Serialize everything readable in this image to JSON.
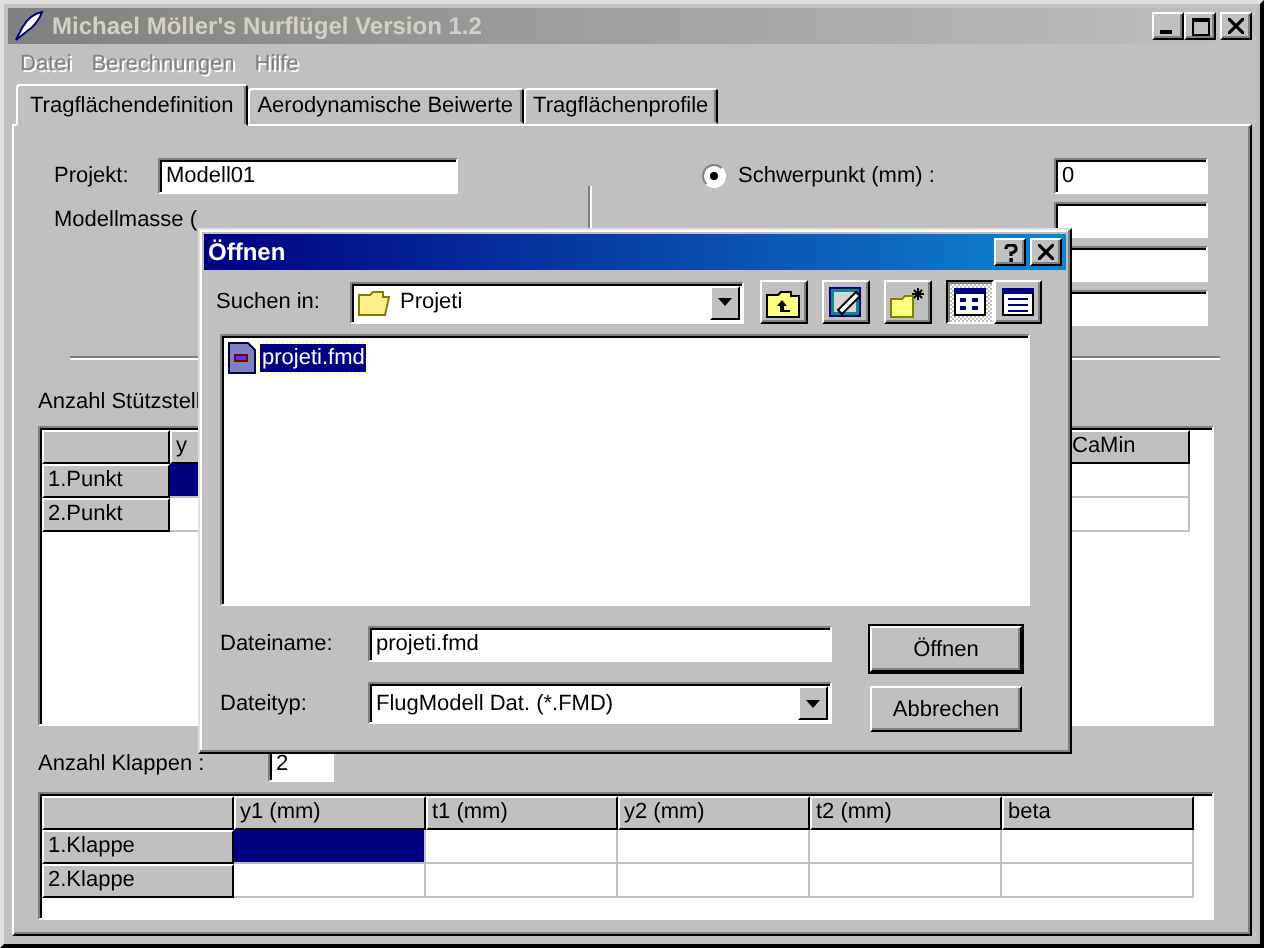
{
  "window": {
    "title": "Michael Möller's Nurflügel Version 1.2",
    "active": false
  },
  "menu": [
    {
      "label": "Datei",
      "disabled": true
    },
    {
      "label": "Berechnungen",
      "disabled": true
    },
    {
      "label": "Hilfe",
      "disabled": true
    }
  ],
  "tabs": [
    {
      "label": "Tragflächendefinition",
      "selected": true
    },
    {
      "label": "Aerodynamische Beiwerte",
      "selected": false
    },
    {
      "label": "Tragflächenprofile",
      "selected": false
    }
  ],
  "form": {
    "project": {
      "label": "Projekt:",
      "value": "Modell01"
    },
    "mass": {
      "label": "Modellmasse ("
    },
    "options": [
      {
        "label": "Schwerpunkt (mm) :",
        "selected": true,
        "value": "0"
      }
    ]
  },
  "support_points": {
    "label": "Anzahl Stützstell",
    "columns": [
      "y",
      "CaMin"
    ],
    "rows": [
      {
        "label": "1.Punkt",
        "cells": [
          {
            "selected": true
          },
          {
            "selected": false
          }
        ]
      },
      {
        "label": "2.Punkt",
        "cells": [
          {
            "selected": false
          },
          {
            "selected": false
          }
        ]
      }
    ]
  },
  "flaps": {
    "label": "Anzahl Klappen :",
    "value": "2",
    "columns": [
      "y1 (mm)",
      "t1 (mm)",
      "y2 (mm)",
      "t2 (mm)",
      "beta"
    ],
    "rows": [
      {
        "label": "1.Klappe",
        "cells": [
          {
            "selected": true
          },
          {
            "selected": false
          },
          {
            "selected": false
          },
          {
            "selected": false
          },
          {
            "selected": false
          }
        ]
      },
      {
        "label": "2.Klappe",
        "cells": [
          {
            "selected": false
          },
          {
            "selected": false
          },
          {
            "selected": false
          },
          {
            "selected": false
          },
          {
            "selected": false
          }
        ]
      }
    ]
  },
  "dialog": {
    "title": "Öffnen",
    "active": true,
    "look_in": {
      "label": "Suchen in:",
      "value": "Projeti"
    },
    "view_buttons": [
      {
        "kind": "list",
        "selected": true
      },
      {
        "kind": "details",
        "selected": false
      }
    ],
    "files": [
      {
        "name": "projeti.fmd",
        "selected": true
      }
    ],
    "filename": {
      "label": "Dateiname:",
      "value": "projeti.fmd"
    },
    "filetype": {
      "label": "Dateityp:",
      "value": "FlugModell Dat. (*.FMD)"
    },
    "buttons": [
      {
        "label": "Öffnen",
        "default": true
      },
      {
        "label": "Abbrechen",
        "default": false
      }
    ]
  }
}
